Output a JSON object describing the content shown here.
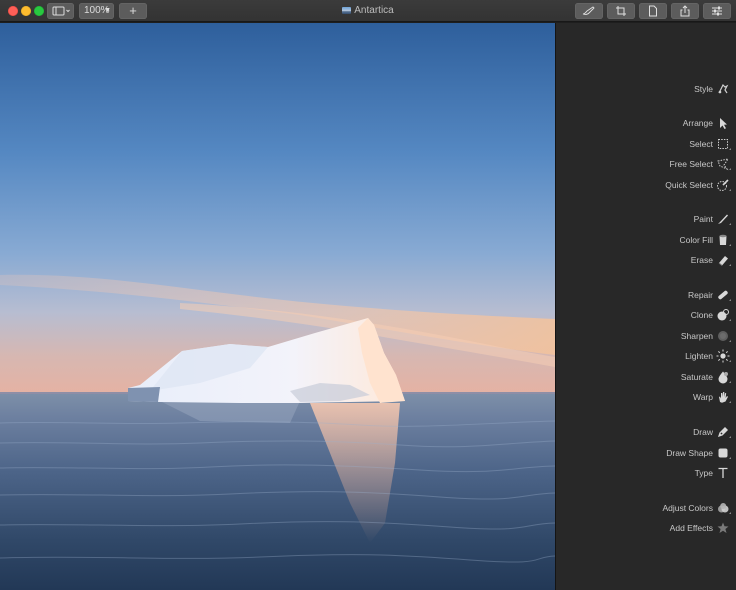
{
  "window": {
    "title": "Antartica"
  },
  "toolbar": {
    "zoom_label": "100%",
    "add_label": "+",
    "right_buttons": [
      "brush-icon",
      "crop-icon",
      "document-icon",
      "share-icon",
      "sliders-icon"
    ]
  },
  "sidebar": {
    "tools": [
      {
        "label": "Style",
        "icon": "style-icon"
      },
      {
        "label": "Arrange",
        "icon": "arrow-pointer-icon"
      },
      {
        "label": "Select",
        "icon": "rect-select-icon"
      },
      {
        "label": "Free Select",
        "icon": "lasso-icon"
      },
      {
        "label": "Quick Select",
        "icon": "magic-select-icon"
      },
      {
        "label": "Paint",
        "icon": "paintbrush-icon"
      },
      {
        "label": "Color Fill",
        "icon": "paint-bucket-icon"
      },
      {
        "label": "Erase",
        "icon": "eraser-icon"
      },
      {
        "label": "Repair",
        "icon": "bandage-icon"
      },
      {
        "label": "Clone",
        "icon": "clone-stamp-icon"
      },
      {
        "label": "Sharpen",
        "icon": "sharpen-icon"
      },
      {
        "label": "Lighten",
        "icon": "sun-icon"
      },
      {
        "label": "Saturate",
        "icon": "saturate-icon"
      },
      {
        "label": "Warp",
        "icon": "hand-icon"
      },
      {
        "label": "Draw",
        "icon": "pen-icon"
      },
      {
        "label": "Draw Shape",
        "icon": "shape-icon"
      },
      {
        "label": "Type",
        "icon": "text-icon"
      },
      {
        "label": "Adjust Colors",
        "icon": "color-circles-icon"
      },
      {
        "label": "Add Effects",
        "icon": "star-icon"
      }
    ]
  },
  "colors": {
    "sidebar_bg": "#282828",
    "titlebar_bg": "#333333",
    "label_text": "#c8c8c8"
  }
}
